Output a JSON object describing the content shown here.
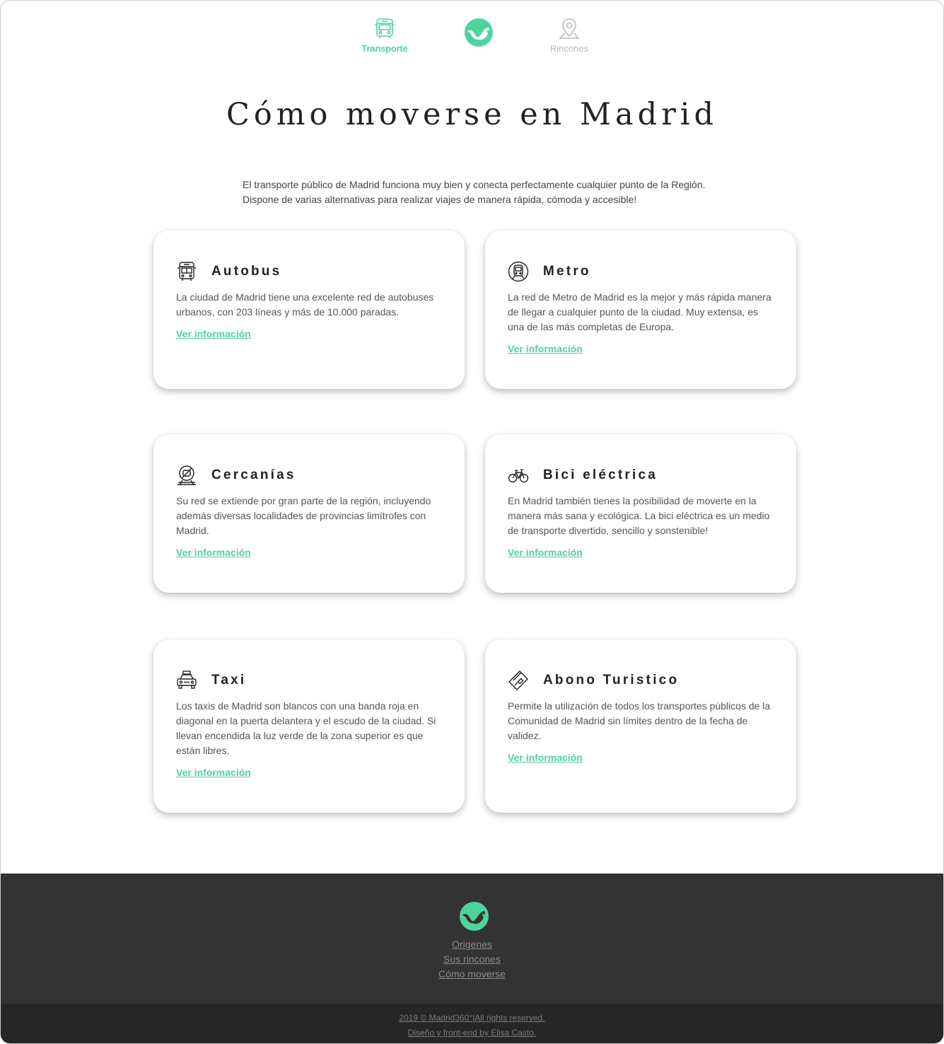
{
  "nav": {
    "transport_label": "Transporte",
    "rincones_label": "Rincones",
    "active_color": "#4fd39c",
    "inactive_color": "#b8b8b8"
  },
  "main": {
    "title": "Cómo moverse en Madrid",
    "intro_line1": "El transporte público de Madrid funciona muy bien y conecta perfectamente cualquier punto de la Región.",
    "intro_line2": "Dispone de varias alternativas para realizar viajes de manera rápida, cómoda y accesible!"
  },
  "cards": [
    {
      "icon": "bus-icon",
      "title": "Autobus",
      "text": "La ciudad de Madrid tiene una excelente red de autobuses urbanos, con 203 líneas y más de 10.000 paradas.",
      "link": "Ver información"
    },
    {
      "icon": "metro-icon",
      "title": "Metro",
      "text": "La red de Metro de Madrid es la mejor y más rápida manera de llegar a cualquier punto de la ciudad. Muy extensa, es una de las más completas de Europa.",
      "link": "Ver información"
    },
    {
      "icon": "train-icon",
      "title": "Cercanías",
      "text": "Su red se extiende por gran parte de la región, incluyendo además diversas localidades de provincias limítrofes con Madrid.",
      "link": "Ver información"
    },
    {
      "icon": "bicycle-icon",
      "title": "Bici eléctrica",
      "text": "En Madrid también tienes la posibilidad de moverte en la manera más sana y ecológica. La bici eléctrica es un medio de transporte divertido, sencillo y sonstenible!",
      "link": "Ver información"
    },
    {
      "icon": "taxi-icon",
      "title": "Taxi",
      "text": "Los taxis de Madrid son blancos con una banda roja en diagonal en la puerta delantera y el escudo de la ciudad. Si llevan encendida la luz verde de la zona superior es que están libres.",
      "link": "Ver información"
    },
    {
      "icon": "card-icon",
      "title": "Abono Turistico",
      "text": "Permite la utilización de todos los transportes públicos de la Comunidad de Madrid sin límites dentro de la fecha de validez.",
      "link": "Ver información"
    }
  ],
  "footer": {
    "links": [
      "Origenes",
      "Sus rincones",
      "Cómo moverse"
    ],
    "copyright": "2019 © Madrid360°|All rights reserved.",
    "credit": "Diseño y front-end by Elisa Casto.",
    "bg_color": "#333333",
    "sub_bg_color": "#262626"
  }
}
